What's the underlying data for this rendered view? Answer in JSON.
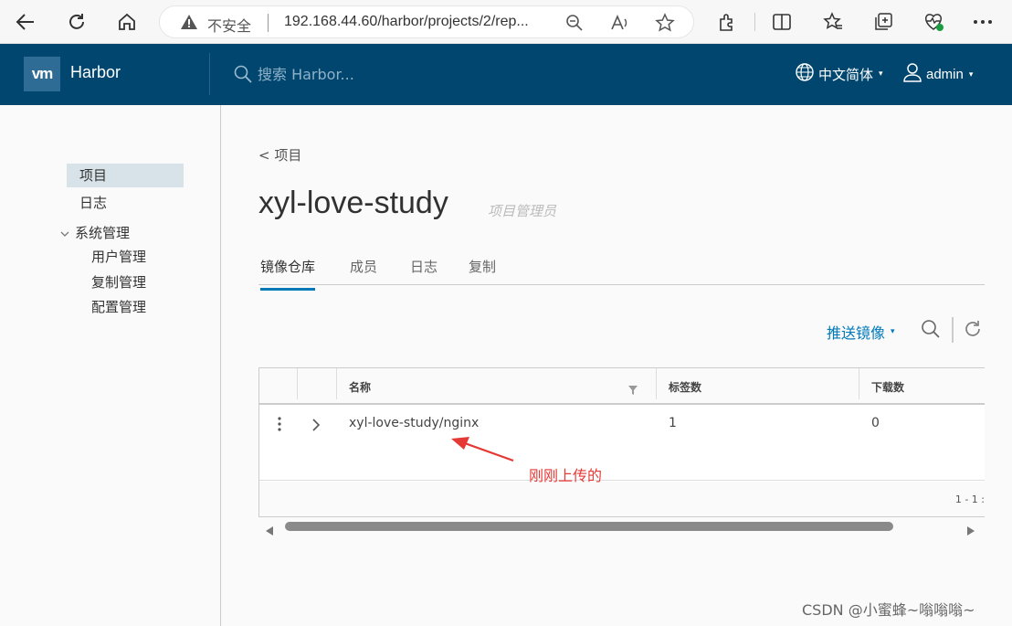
{
  "browser": {
    "insecure_label": "不安全",
    "url": "192.168.44.60/harbor/projects/2/rep..."
  },
  "header": {
    "app_title": "Harbor",
    "logo_text": "vm",
    "search_placeholder": "搜索 Harbor...",
    "language": "中文简体",
    "user": "admin"
  },
  "sidebar": {
    "items": [
      {
        "label": "项目",
        "active": true
      },
      {
        "label": "日志",
        "active": false
      }
    ],
    "group": {
      "label": "系统管理",
      "children": [
        "用户管理",
        "复制管理",
        "配置管理"
      ]
    }
  },
  "main": {
    "breadcrumb": "< 项目",
    "project_name": "xyl-love-study",
    "project_role": "项目管理员",
    "tabs": [
      {
        "label": "镜像仓库",
        "active": true
      },
      {
        "label": "成员",
        "active": false
      },
      {
        "label": "日志",
        "active": false
      },
      {
        "label": "复制",
        "active": false
      }
    ],
    "push_label": "推送镜像",
    "grid": {
      "columns": [
        "名称",
        "标签数",
        "下载数"
      ],
      "rows": [
        {
          "name": "xyl-love-study/nginx",
          "tags": "1",
          "pulls": "0"
        }
      ],
      "pagination": "1 - 1 :"
    }
  },
  "annotation": "刚刚上传的",
  "watermark": "CSDN @小蜜蜂~嗡嗡嗡~",
  "colors": {
    "header_bg": "#01466e",
    "accent": "#0079b8",
    "annotation": "#e53935"
  }
}
